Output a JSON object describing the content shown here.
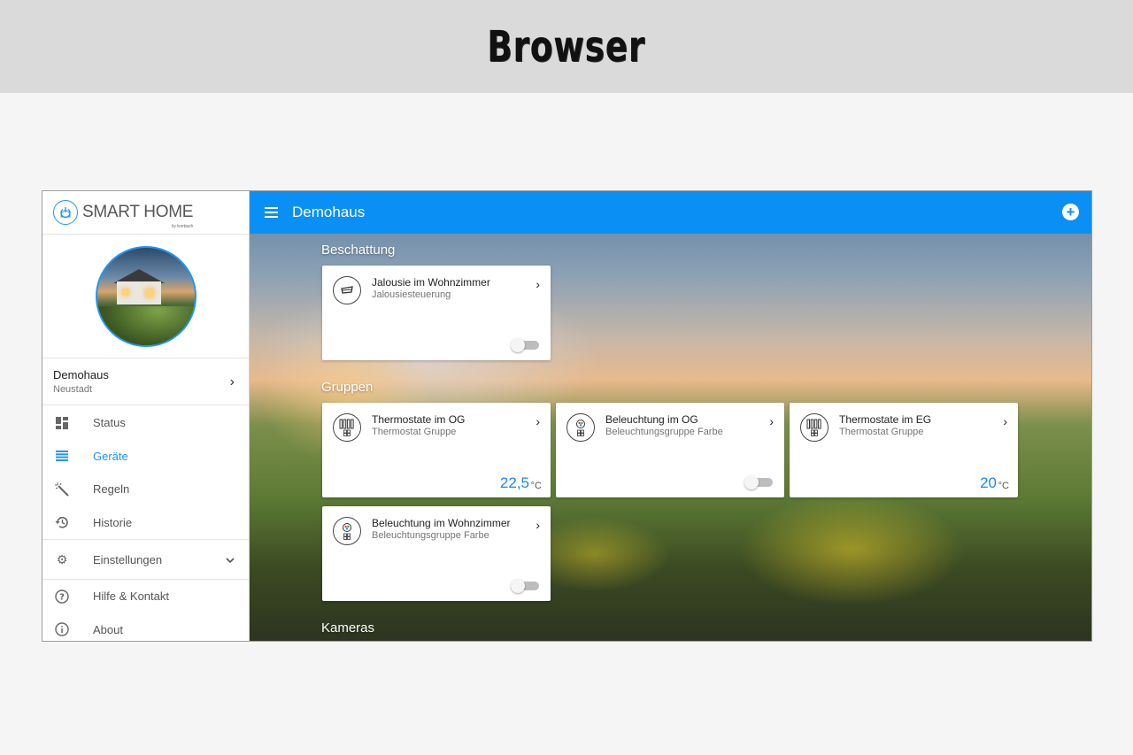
{
  "banner": {
    "title": "Browser"
  },
  "sidebar": {
    "logo_text": "SMART HOME",
    "logo_sub": "by hornbach",
    "location": {
      "name": "Demohaus",
      "sub": "Neustadt"
    },
    "nav": [
      {
        "label": "Status",
        "icon": "dashboard-icon"
      },
      {
        "label": "Geräte",
        "icon": "list-icon",
        "active": true
      },
      {
        "label": "Regeln",
        "icon": "magic-wand-icon"
      },
      {
        "label": "Historie",
        "icon": "history-icon"
      },
      {
        "label": "Einstellungen",
        "icon": "gear-icon"
      },
      {
        "label": "Hilfe & Kontakt",
        "icon": "help-icon"
      },
      {
        "label": "About",
        "icon": "info-icon"
      }
    ]
  },
  "header": {
    "title": "Demohaus"
  },
  "sections": {
    "beschattung": "Beschattung",
    "gruppen": "Gruppen",
    "kameras": "Kameras"
  },
  "cards": [
    {
      "title": "Jalousie im Wohnzimmer",
      "sub": "Jalousiesteuerung",
      "icon": "blind-icon",
      "toggle": "off"
    },
    {
      "title": "Thermostate im OG",
      "sub": "Thermostat Gruppe",
      "icon": "radiator-icon",
      "temp": "22,5",
      "unit": "°C"
    },
    {
      "title": "Beleuchtung im OG",
      "sub": "Beleuchtungsgruppe Farbe",
      "icon": "bulb-icon",
      "toggle": "off"
    },
    {
      "title": "Thermostate im EG",
      "sub": "Thermostat Gruppe",
      "icon": "radiator-icon",
      "temp": "20",
      "unit": "°C"
    },
    {
      "title": "Beleuchtung im Wohnzimmer",
      "sub": "Beleuchtungsgruppe Farbe",
      "icon": "bulb-icon",
      "toggle": "off"
    }
  ],
  "colors": {
    "accent": "#0a8ff5",
    "temp": "#1e88e5"
  }
}
